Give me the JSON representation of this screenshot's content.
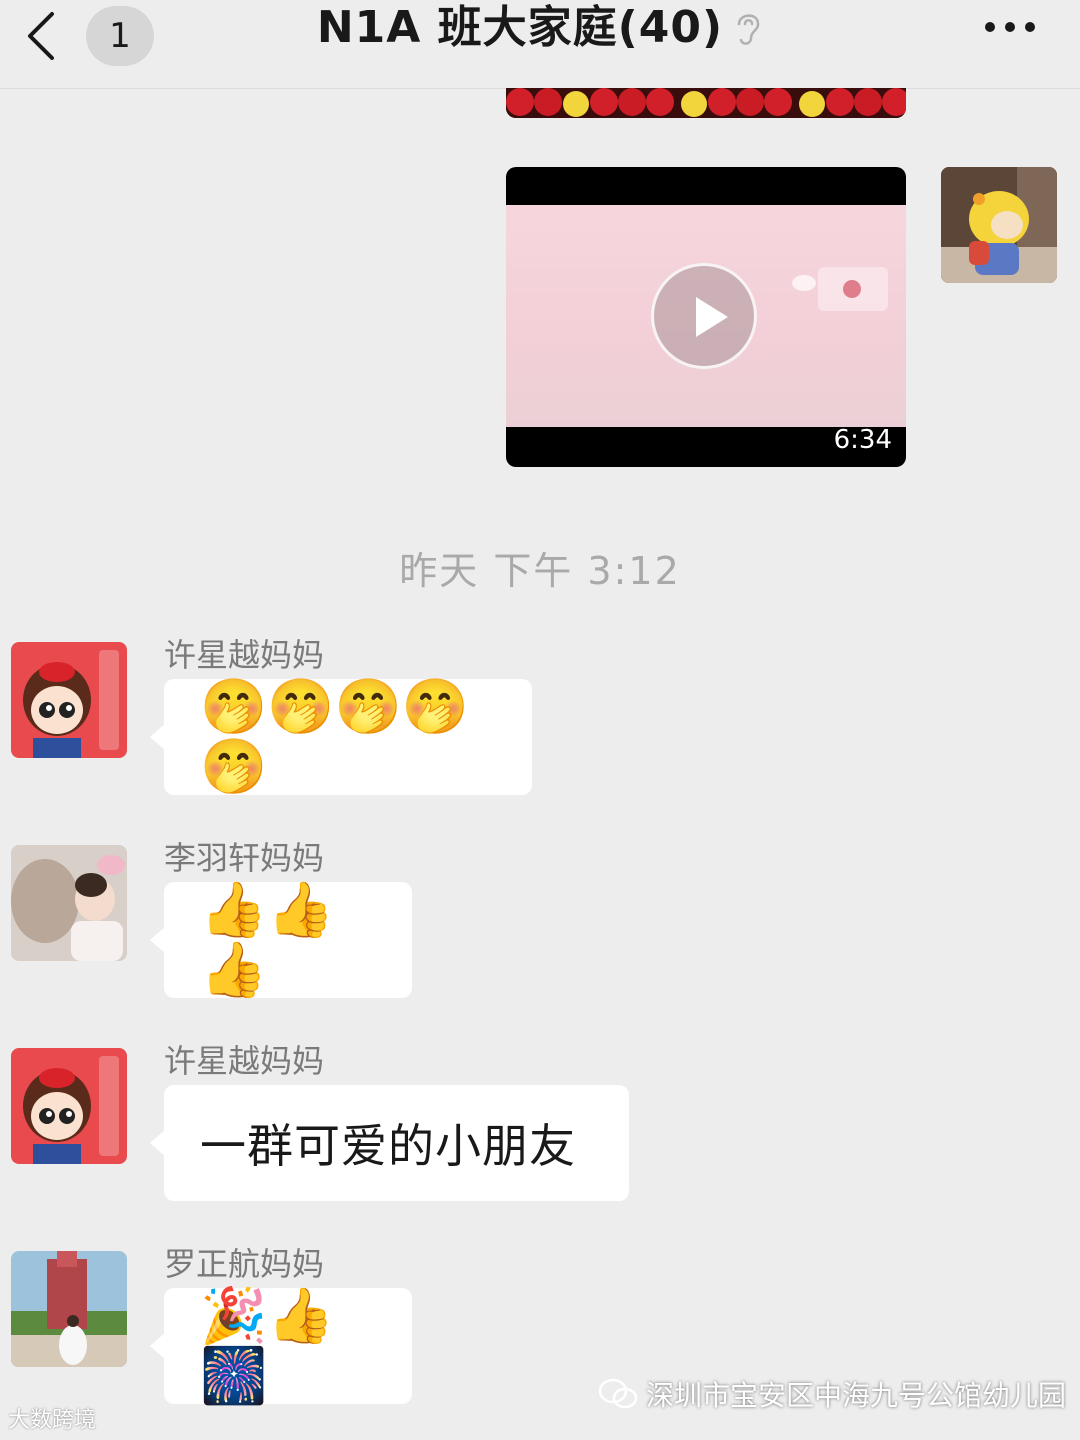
{
  "header": {
    "back_badge": "1",
    "title": "N1A 班大家庭(40)",
    "ear_icon": "ear-icon",
    "more_icon": "more-icon"
  },
  "video": {
    "duration": "6:34"
  },
  "timestamp": "昨天 下午 3:12",
  "messages": [
    {
      "sender": "许星越妈妈",
      "content": "🤭🤭🤭🤭🤭"
    },
    {
      "sender": "李羽轩妈妈",
      "content": "👍👍👍"
    },
    {
      "sender": "许星越妈妈",
      "content": "一群可爱的小朋友"
    },
    {
      "sender": "罗正航妈妈",
      "content": "🎉👍🎆"
    }
  ],
  "watermarks": {
    "left": "大数跨境",
    "right": "深圳市宝安区中海九号公馆幼儿园"
  },
  "colors": {
    "background": "#ededed",
    "bubble": "#ffffff",
    "timestamp": "#a9a9a9"
  }
}
